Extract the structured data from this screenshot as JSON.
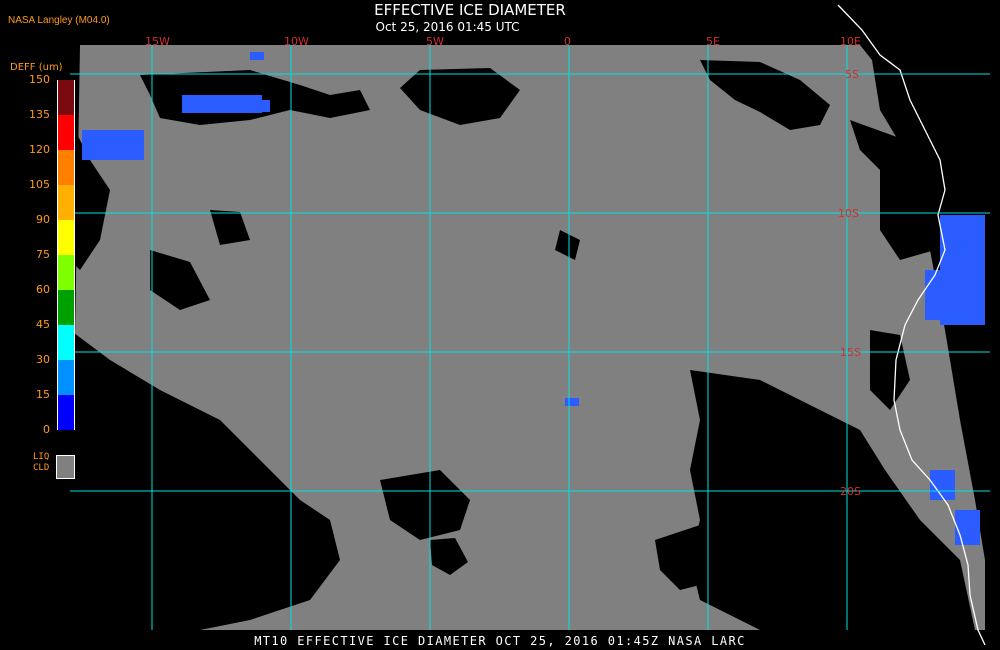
{
  "header": {
    "credit": "NASA Langley (M04.0)",
    "title": "EFFECTIVE ICE DIAMETER",
    "subtitle": "Oct 25, 2016 01:45 UTC"
  },
  "footer": {
    "caption": "MT10  EFFECTIVE ICE DIAMETER   OCT 25, 2016 01:45Z   NASA LARC"
  },
  "legend": {
    "title": "DEFF (um)",
    "ticks": [
      "150",
      "135",
      "120",
      "105",
      "90",
      "75",
      "60",
      "45",
      "30",
      "15",
      "0"
    ],
    "colors": [
      "#7a0a10",
      "#ff0000",
      "#ff8000",
      "#ffb000",
      "#ffff00",
      "#80ff00",
      "#00a000",
      "#00ffff",
      "#0090ff",
      "#0000ff",
      "#8a3cff"
    ],
    "liquid_label_1": "LIQ",
    "liquid_label_2": "CLD",
    "liquid_color": "#808080"
  },
  "map": {
    "background": "#000000",
    "cloud_color": "#808080",
    "grid_color": "#00e0e0",
    "label_color": "#d03030",
    "ice_color": "#2a5cff",
    "coast_color": "#ffffff",
    "lon_labels": [
      "15W",
      "10W",
      "5W",
      "0",
      "5E",
      "10E"
    ],
    "lat_labels": [
      "5S",
      "10S",
      "15S",
      "20S"
    ]
  }
}
